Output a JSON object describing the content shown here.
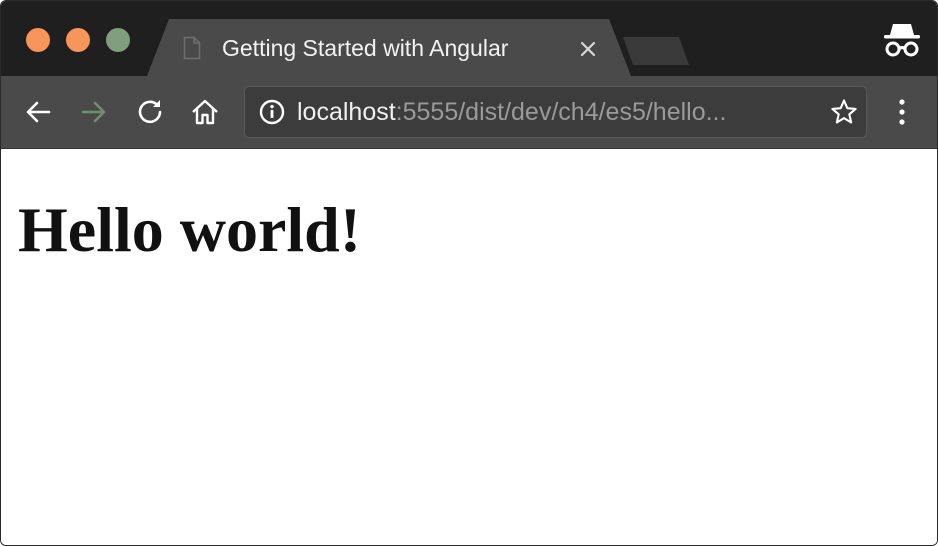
{
  "tab": {
    "title": "Getting Started with Angular",
    "page_icon": "document-icon",
    "close_icon": "close-icon"
  },
  "window_controls": {
    "close_color": "#f8955a",
    "minimize_color": "#f8955a",
    "maximize_color": "#7f9f7f"
  },
  "toolbar": {
    "back_icon": "arrow-left-icon",
    "forward_icon": "arrow-right-icon",
    "reload_icon": "reload-icon",
    "home_icon": "home-icon",
    "menu_icon": "more-vertical-icon"
  },
  "address_bar": {
    "host": "localhost",
    "path": ":5555/dist/dev/ch4/es5/hello...",
    "info_icon": "info-icon",
    "bookmark_icon": "star-icon"
  },
  "incognito_icon": "incognito-icon",
  "page": {
    "heading": "Hello world!"
  },
  "colors": {
    "tabstrip_bg": "#1f1f1f",
    "toolbar_bg": "#4a4a4a",
    "forward_disabled": "#6f8f6f"
  }
}
